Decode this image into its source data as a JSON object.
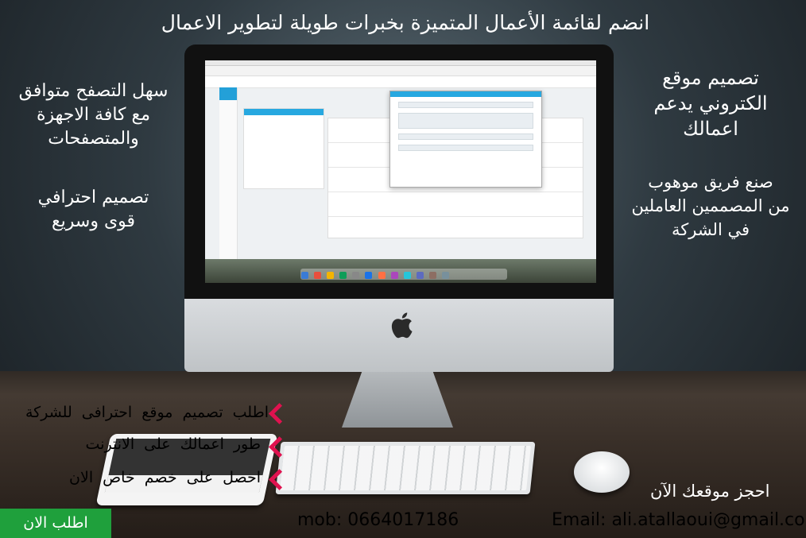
{
  "headline": "انضم لقائمة الأعمال المتميزة بخبرات طويلة لتطوير الاعمال",
  "left_features": [
    {
      "lines": [
        "سهل التصفح متوافق",
        "مع كافة الاجهزة",
        "والمتصفحات"
      ]
    },
    {
      "lines": [
        "تصميم احترافي",
        "قوى وسريع"
      ]
    }
  ],
  "right_features": [
    {
      "lines": [
        "تصميم موقع",
        "الكتروني يدعم",
        "اعمالك"
      ]
    },
    {
      "lines": [
        "صنع فريق موهوب",
        "من المصممين العاملين",
        "في الشركة"
      ]
    }
  ],
  "cta_items": [
    "اطلب تصميم موقع احترافى للشركة",
    "طور اعمالك على الانترنت",
    "احصل على خصم خاص الان"
  ],
  "order_button": "اطلب الان",
  "book_label": "احجز موقعك الآن",
  "mobile": "mob:  0664017186",
  "email": "Email:  ali.atallaoui@gmail.com",
  "colors": {
    "accent_chevron": "#e0124f",
    "button_green": "#1fa03c",
    "app_blue": "#27a8e0"
  }
}
